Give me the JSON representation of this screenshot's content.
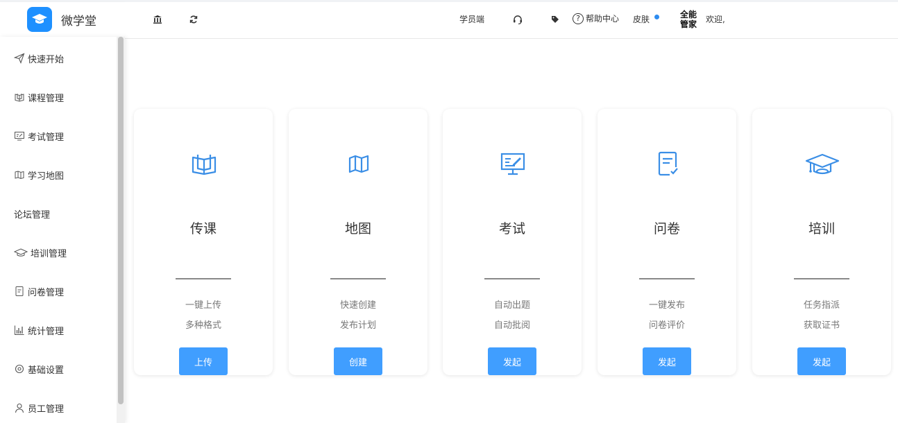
{
  "brand": {
    "name": "微学堂",
    "accent": "#1e90ff"
  },
  "header": {
    "student_portal": "学员端",
    "help_center": "帮助中心",
    "help_symbol": "?",
    "skin": "皮肤",
    "manager_line1": "全能",
    "manager_line2": "管家",
    "welcome": "欢迎,",
    "icons": [
      "bank-icon",
      "refresh-icon",
      "headset-icon",
      "tag-icon",
      "help-icon"
    ]
  },
  "sidebar": {
    "items": [
      {
        "label": "快速开始",
        "icon": "paper-plane-icon"
      },
      {
        "label": "课程管理",
        "icon": "book-icon"
      },
      {
        "label": "考试管理",
        "icon": "exam-icon"
      },
      {
        "label": "学习地图",
        "icon": "map-icon"
      },
      {
        "label": "论坛管理",
        "icon": ""
      },
      {
        "label": "培训管理",
        "icon": "graduation-cap-icon"
      },
      {
        "label": "问卷管理",
        "icon": "document-icon"
      },
      {
        "label": "统计管理",
        "icon": "bar-chart-icon"
      },
      {
        "label": "基础设置",
        "icon": "settings-icon"
      },
      {
        "label": "员工管理",
        "icon": "user-icon"
      }
    ]
  },
  "cards": [
    {
      "title": "传课",
      "desc1": "一键上传",
      "desc2": "多种格式",
      "button": "上传",
      "icon": "book-icon"
    },
    {
      "title": "地图",
      "desc1": "快速创建",
      "desc2": "发布计划",
      "button": "创建",
      "icon": "map-icon"
    },
    {
      "title": "考试",
      "desc1": "自动出题",
      "desc2": "自动批阅",
      "button": "发起",
      "icon": "exam-icon"
    },
    {
      "title": "问卷",
      "desc1": "一键发布",
      "desc2": "问卷评价",
      "button": "发起",
      "icon": "survey-icon"
    },
    {
      "title": "培训",
      "desc1": "任务指派",
      "desc2": "获取证书",
      "button": "发起",
      "icon": "graduation-cap-icon"
    }
  ],
  "colors": {
    "primary_button": "#409eff",
    "icon_blue": "#3a8ee6",
    "skin_dot": "#2d8cf0"
  }
}
